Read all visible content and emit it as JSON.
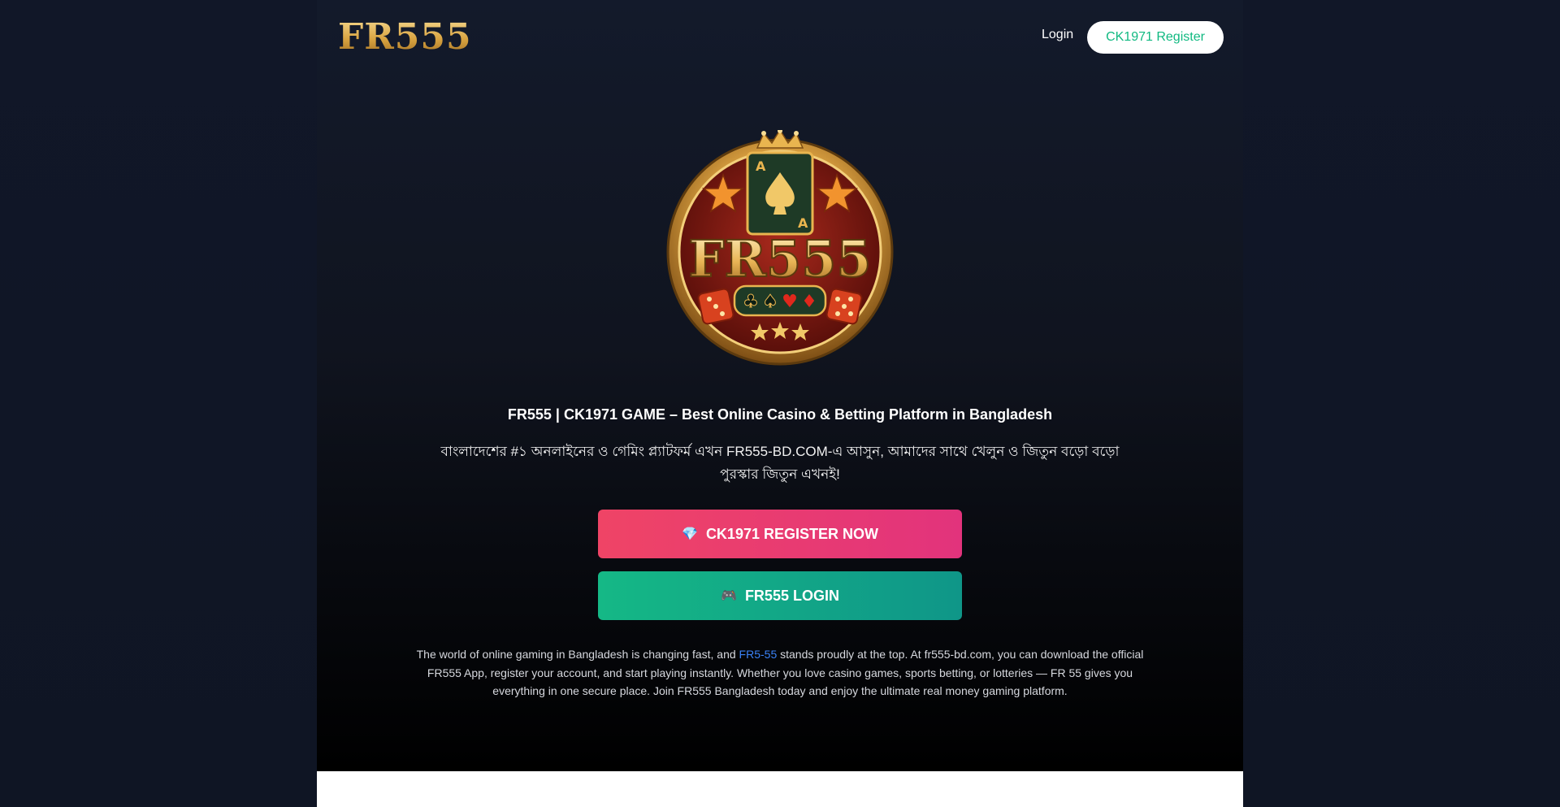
{
  "header": {
    "logo": "FR555",
    "login_label": "Login",
    "register_label": "CK1971 Register"
  },
  "hero": {
    "emblem_text": "FR555",
    "emblem_card_letter": "A",
    "title": "FR555 | CK1971 GAME – Best Online Casino & Betting Platform in Bangladesh",
    "subtitle": "বাংলাদেশের #১ অনলাইনের ও গেমিং প্ল্যাটফর্ম এখন FR555-BD.COM-এ আসুন, আমাদের সাথে খেলুন ও জিতুন বড়ো বড়ো পুরস্কার জিতুন এখনই!",
    "register_button": "CK1971 REGISTER NOW",
    "register_icon": "💎",
    "login_button": "FR555 LOGIN",
    "login_icon": "🎮",
    "description_part1": "The world of online gaming in Bangladesh is changing fast, and ",
    "description_link": "FR5-55",
    "description_part2": " stands proudly at the top. At fr555-bd.com, you can download the official FR555 App, register your account, and start playing instantly. Whether you love casino games, sports betting, or lotteries — FR 55 gives you everything in one secure place. Join FR555 Bangladesh today and enjoy the ultimate real money gaming platform."
  },
  "colors": {
    "accent_green": "#10b981",
    "register_pink": "#e2337c",
    "gold": "#d9a441",
    "link_blue": "#3b82f6"
  }
}
